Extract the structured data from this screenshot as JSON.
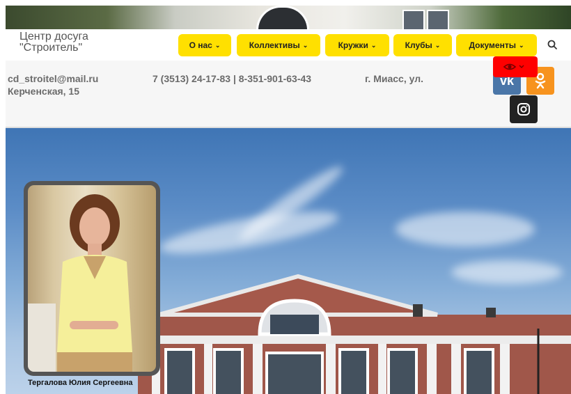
{
  "site": {
    "logo_line1": "Центр досуга",
    "logo_line2": "\"Строитель\""
  },
  "nav": {
    "items": [
      {
        "label": "О нас"
      },
      {
        "label": "Коллективы"
      },
      {
        "label": "Кружки"
      },
      {
        "label": "Клубы"
      },
      {
        "label": "Документы"
      }
    ],
    "search_icon": "search-icon"
  },
  "contacts": {
    "email": "cd_stroitel@mail.ru",
    "street": "Керченская, 15",
    "phones": "7 (3513) 24-17-83 | 8-351-901-63-43",
    "city": "г. Миасс, ул."
  },
  "social": {
    "vk_icon": "vk-icon",
    "ok_icon": "odnoklassniki-icon",
    "instagram_icon": "instagram-icon",
    "accessibility_icon": "eye-icon"
  },
  "hero": {
    "person_name": "Тергалова Юлия Сергеевна"
  },
  "colors": {
    "nav_yellow": "#ffe000",
    "accessibility_red": "#ff0000",
    "vk_blue": "#4a76a8",
    "ok_orange": "#f7931e",
    "instagram_dark": "#222222"
  }
}
